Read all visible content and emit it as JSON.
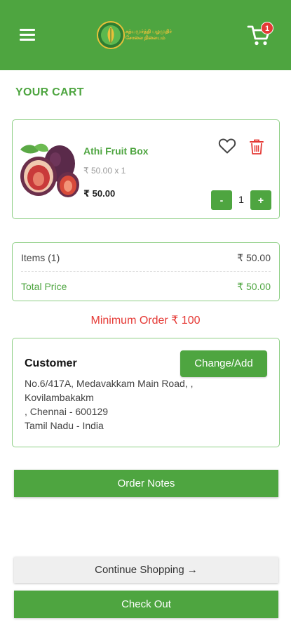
{
  "colors": {
    "primary": "#4ea540",
    "danger": "#e53935",
    "muted": "#9a9a9a"
  },
  "header": {
    "menu_icon": "hamburger-menu-icon",
    "logo_icon": "brand-logo",
    "cart_icon": "shopping-cart-icon",
    "cart_count": "1"
  },
  "page": {
    "title": "YOUR CART"
  },
  "cart": {
    "items": [
      {
        "name": "Athi Fruit Box",
        "unit_line": "₹ 50.00 x 1",
        "price": "₹ 50.00",
        "quantity": "1",
        "minus_label": "-",
        "plus_label": "+",
        "image_icon": "fig-fruit-image",
        "wishlist_icon": "heart-outline-icon",
        "delete_icon": "trash-icon"
      }
    ]
  },
  "summary": {
    "items_label": "Items (1)",
    "items_value": "₹ 50.00",
    "total_label": "Total Price",
    "total_value": "₹ 50.00"
  },
  "min_order": "Minimum Order ₹ 100",
  "customer": {
    "title": "Customer",
    "change_label": "Change/Add",
    "address_lines": [
      "No.6/417A, Medavakkam Main Road, ,",
      "Kovilambakakm",
      ", Chennai - 600129",
      "Tamil Nadu - India"
    ]
  },
  "buttons": {
    "order_notes": "Order Notes",
    "continue_shopping": "Continue Shopping →",
    "check_out": "Check Out"
  }
}
